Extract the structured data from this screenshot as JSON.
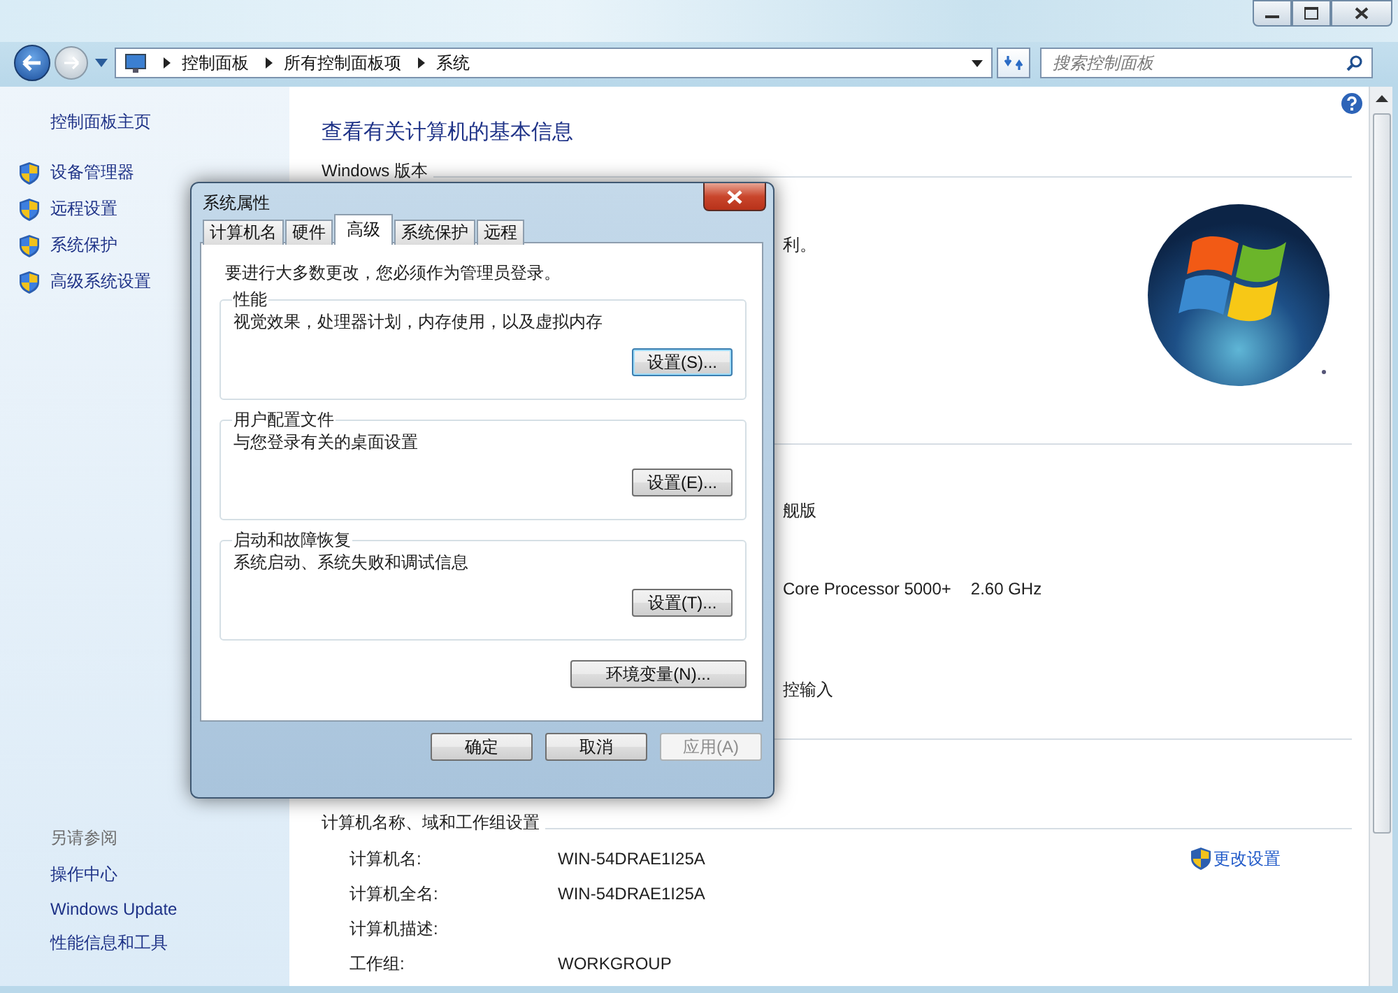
{
  "address_bar": {
    "breadcrumb": [
      "控制面板",
      "所有控制面板项",
      "系统"
    ],
    "search": {
      "placeholder": "搜索控制面板"
    }
  },
  "sidebar": {
    "home": "控制面板主页",
    "tasks": [
      "设备管理器",
      "远程设置",
      "系统保护",
      "高级系统设置"
    ],
    "see_also_title": "另请参阅",
    "see_also": [
      "操作中心",
      "Windows Update",
      "性能信息和工具"
    ]
  },
  "content": {
    "heading": "查看有关计算机的基本信息",
    "windows_section": {
      "title": "Windows 版本",
      "fragment": "利。"
    },
    "system_section": {
      "fragments": [
        [
          "舰版"
        ],
        [
          "Core Processor 5000+",
          "2.60 GHz"
        ],
        [
          "控输入"
        ]
      ]
    },
    "name_section": {
      "title": "计算机名称、域和工作组设置",
      "change_link": "更改设置",
      "rows": [
        {
          "label": "计算机名:",
          "value": "WIN-54DRAE1I25A"
        },
        {
          "label": "计算机全名:",
          "value": "WIN-54DRAE1I25A"
        },
        {
          "label": "计算机描述:"
        },
        {
          "label": "工作组:",
          "value": "WORKGROUP"
        }
      ]
    }
  },
  "dialog": {
    "title": "系统属性",
    "tabs": [
      {
        "label": "计算机名",
        "selected": false
      },
      {
        "label": "硬件",
        "selected": false
      },
      {
        "label": "高级",
        "selected": true
      },
      {
        "label": "系统保护",
        "selected": false
      },
      {
        "label": "远程",
        "selected": false
      }
    ],
    "notice": "要进行大多数更改，您必须作为管理员登录。",
    "groups": [
      {
        "title": "性能",
        "description": "视觉效果，处理器计划，内存使用，以及虚拟内存",
        "button": "设置(S)...",
        "focused": true
      },
      {
        "title": "用户配置文件",
        "description": "与您登录有关的桌面设置",
        "button": "设置(E)...",
        "focused": false
      },
      {
        "title": "启动和故障恢复",
        "description": "系统启动、系统失败和调试信息",
        "button": "设置(T)...",
        "focused": false
      }
    ],
    "env_button": "环境变量(N)...",
    "buttons": [
      {
        "label": "确定",
        "disabled": false
      },
      {
        "label": "取消",
        "disabled": false
      },
      {
        "label": "应用(A)",
        "disabled": true
      }
    ]
  }
}
